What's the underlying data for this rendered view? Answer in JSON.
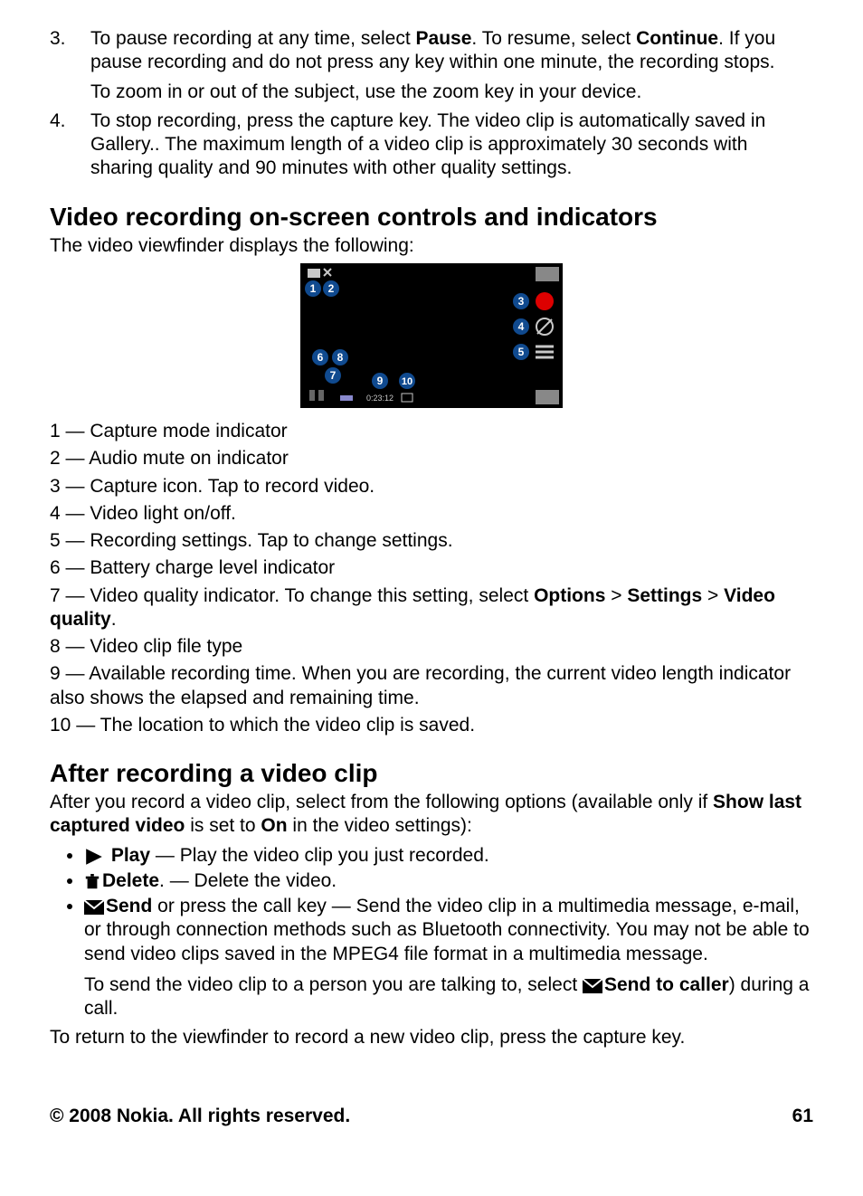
{
  "steps": {
    "s3": {
      "num": "3.",
      "p1a": "To pause recording at any time, select ",
      "p1b": "Pause",
      "p1c": ". To resume, select ",
      "p1d": "Continue",
      "p1e": ". If you pause recording and do not press any key within one minute, the recording stops.",
      "p2": "To zoom in or out of the subject, use the zoom key in your device."
    },
    "s4": {
      "num": "4.",
      "text": "To stop recording, press the capture key. The video clip is automatically saved in Gallery.. The maximum length of a video clip is approximately 30 seconds with sharing quality and 90 minutes with other quality settings."
    }
  },
  "h2_1": "Video recording on-screen controls and indicators",
  "intro1": "The video viewfinder displays the following:",
  "figure": {
    "time": "0:23:12",
    "labels": {
      "n1": "1",
      "n2": "2",
      "n3": "3",
      "n4": "4",
      "n5": "5",
      "n6": "6",
      "n7": "7",
      "n8": "8",
      "n9": "9",
      "n10": "10"
    }
  },
  "indicators": {
    "i1": "1 — Capture mode indicator",
    "i2": "2 — Audio mute on indicator",
    "i3": "3 — Capture icon. Tap to record video.",
    "i4": "4 — Video light on/off.",
    "i5": "5 — Recording settings. Tap to change settings.",
    "i6": "6 — Battery charge level indicator",
    "i7a": "7 — Video quality indicator. To change this setting, select ",
    "i7b": "Options",
    "i7c": " > ",
    "i7d": "Settings",
    "i7e": " > ",
    "i7f": "Video quality",
    "i7g": ".",
    "i8": "8 — Video clip file type",
    "i9": "9 — Available recording time. When you are recording, the current video length indicator also shows the elapsed and remaining time.",
    "i10": "10 — The location to which the video clip is saved."
  },
  "h2_2": "After recording a video clip",
  "after_intro_a": "After you record a video clip, select from the following options (available only if ",
  "after_intro_b": "Show last captured video",
  "after_intro_c": " is set to ",
  "after_intro_d": "On",
  "after_intro_e": " in the video settings):",
  "bullets": {
    "play": {
      "label": "Play",
      "text": "  — Play the video clip you just recorded."
    },
    "delete": {
      "label": "Delete",
      "labeldot": ".",
      "text": "  — Delete the video."
    },
    "send": {
      "label": "Send",
      "text": " or press the call key  — Send the video clip in a multimedia message, e-mail, or through connection methods such as Bluetooth connectivity. You may not be able to send video clips saved in the MPEG4 file format in a multimedia message.",
      "sub_a": "To send the video clip to a person you are talking to, select ",
      "sub_b": "Send to caller",
      "sub_c": ") during a call."
    }
  },
  "return_text": "To return to the viewfinder to record a new video clip, press the capture key.",
  "footer": {
    "left": "© 2008 Nokia. All rights reserved.",
    "right": "61"
  }
}
